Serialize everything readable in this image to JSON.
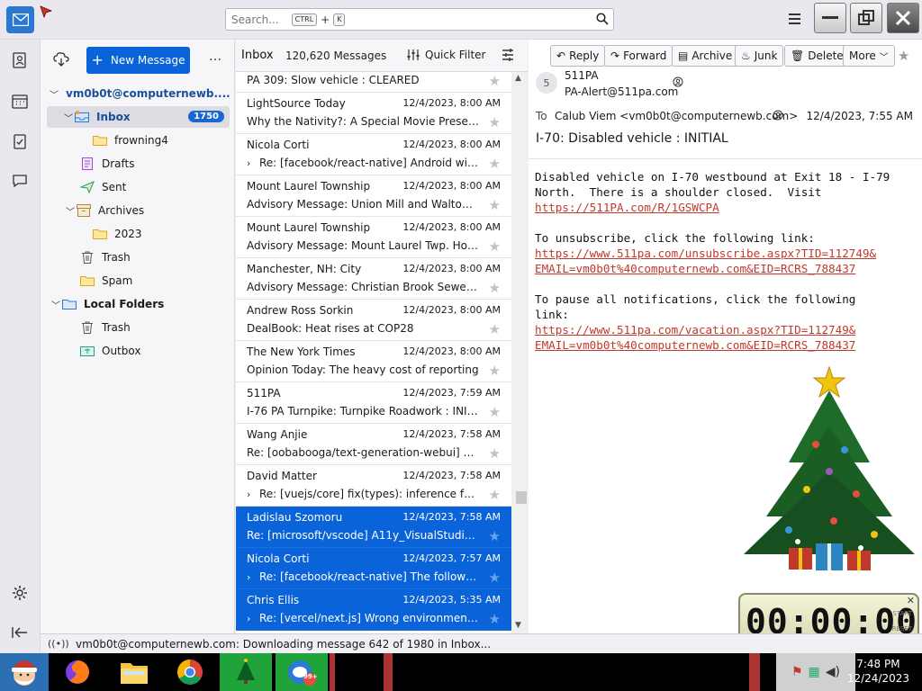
{
  "search": {
    "placeholder": "Search...",
    "shortcut_key1": "CTRL",
    "shortcut_plus": "+",
    "shortcut_key2": "K"
  },
  "folder_pane": {
    "new_message_label": "New Message",
    "more_label": "…",
    "account": "vm0b0t@computernewb....",
    "inbox_label": "Inbox",
    "inbox_unread": "1750",
    "folders": [
      {
        "label": "frowning4"
      },
      {
        "label": "Drafts"
      },
      {
        "label": "Sent"
      },
      {
        "label": "Archives"
      },
      {
        "label": "2023"
      },
      {
        "label": "Trash"
      },
      {
        "label": "Spam"
      }
    ],
    "local_folders_label": "Local Folders",
    "local_folders": [
      {
        "label": "Trash"
      },
      {
        "label": "Outbox"
      }
    ]
  },
  "message_list": {
    "folder_name": "Inbox",
    "count": "120,620 Messages",
    "quick_filter_label": "Quick Filter",
    "messages": [
      {
        "sender": "",
        "date": "",
        "subject": "PA 309: Slow vehicle : CLEARED",
        "threaded": false,
        "selected": false
      },
      {
        "sender": "LightSource Today",
        "date": "12/4/2023, 8:00 AM",
        "subject": "Why the Nativity?: A Special Movie Presentation",
        "threaded": false,
        "selected": false
      },
      {
        "sender": "Nicola Corti",
        "date": "12/4/2023, 8:00 AM",
        "subject": "Re: [facebook/react-native] Android with...",
        "threaded": true,
        "selected": false
      },
      {
        "sender": "Mount Laurel Township",
        "date": "12/4/2023, 8:00 AM",
        "subject": "Advisory Message: Union Mill and Walton Road",
        "threaded": false,
        "selected": false
      },
      {
        "sender": "Mount Laurel Township",
        "date": "12/4/2023, 8:00 AM",
        "subject": "Advisory Message: Mount Laurel Twp. Holiday",
        "threaded": false,
        "selected": false
      },
      {
        "sender": "Manchester, NH: City",
        "date": "12/4/2023, 8:00 AM",
        "subject": "Advisory Message: Christian Brook Sewer Project",
        "threaded": false,
        "selected": false
      },
      {
        "sender": "Andrew Ross Sorkin",
        "date": "12/4/2023, 8:00 AM",
        "subject": "DealBook: Heat rises at COP28",
        "threaded": false,
        "selected": false
      },
      {
        "sender": "The New York Times",
        "date": "12/4/2023, 8:00 AM",
        "subject": "Opinion Today: The heavy cost of reporting",
        "threaded": false,
        "selected": false
      },
      {
        "sender": "511PA",
        "date": "12/4/2023, 7:59 AM",
        "subject": "I-76 PA Turnpike: Turnpike Roadwork : INITIAL",
        "threaded": false,
        "selected": false
      },
      {
        "sender": "Wang Anjie",
        "date": "12/4/2023, 7:58 AM",
        "subject": "Re: [oobabooga/text-generation-webui] A...",
        "threaded": false,
        "selected": false
      },
      {
        "sender": "David Matter",
        "date": "12/4/2023, 7:58 AM",
        "subject": "Re: [vuejs/core] fix(types): inference for ...",
        "threaded": true,
        "selected": false
      },
      {
        "sender": "Ladislau Szomoru",
        "date": "12/4/2023, 7:58 AM",
        "subject": "Re: [microsoft/vscode] A11y_VisualStudioCode",
        "threaded": false,
        "selected": true
      },
      {
        "sender": "Nicola Corti",
        "date": "12/4/2023, 7:57 AM",
        "subject": "Re: [facebook/react-native] The followin...",
        "threaded": true,
        "selected": true
      },
      {
        "sender": "Chris Ellis",
        "date": "12/4/2023, 5:35 AM",
        "subject": "Re: [vercel/next.js] Wrong environment v...",
        "threaded": true,
        "selected": true
      }
    ]
  },
  "reading_pane": {
    "buttons": {
      "reply": "Reply",
      "forward": "Forward",
      "archive": "Archive",
      "junk": "Junk",
      "delete": "Delete",
      "more": "More"
    },
    "avatar_initial": "5",
    "from_name": "511PA",
    "from_address": "PA-Alert@511pa.com",
    "to_label": "To",
    "to_value": "Calub Viem <vm0b0t@computernewb.com>",
    "datetime": "12/4/2023, 7:55 AM",
    "subject": "I-70: Disabled vehicle : INITIAL",
    "body_line1": "Disabled vehicle on I-70 westbound at Exit 18 - I-79",
    "body_line2": "North.  There is a shoulder closed.  Visit",
    "body_link1": "https://511PA.com/R/1GSWCPA",
    "body_line3": "To unsubscribe, click the following link:",
    "body_link2a": "https://www.511pa.com/unsubscribe.aspx?TID=112749&",
    "body_link2b": "EMAIL=vm0b0t%40computernewb.com&EID=RCRS_788437",
    "body_line4": "To pause all notifications, click the following",
    "body_line5": "link:",
    "body_link3a": "https://www.511pa.com/vacation.aspx?TID=112749&",
    "body_link3b": "EMAIL=vm0b0t%40computernewb.com&EID=RCRS_788437"
  },
  "timer": {
    "display": "00:00:00",
    "close_label": "✕",
    "label_start": "START",
    "label_reset": "RESET"
  },
  "status_bar": {
    "text": "vm0b0t@computernewb.com: Downloading message 642 of 1980 in Inbox..."
  },
  "taskbar": {
    "time": "7:48 PM",
    "date": "12/24/2023",
    "chat_badge": "99+"
  },
  "colors": {
    "accent": "#0a63d8",
    "link": "#c0392b",
    "selected_row": "#0a63d8",
    "badge": "#1a66d2"
  }
}
